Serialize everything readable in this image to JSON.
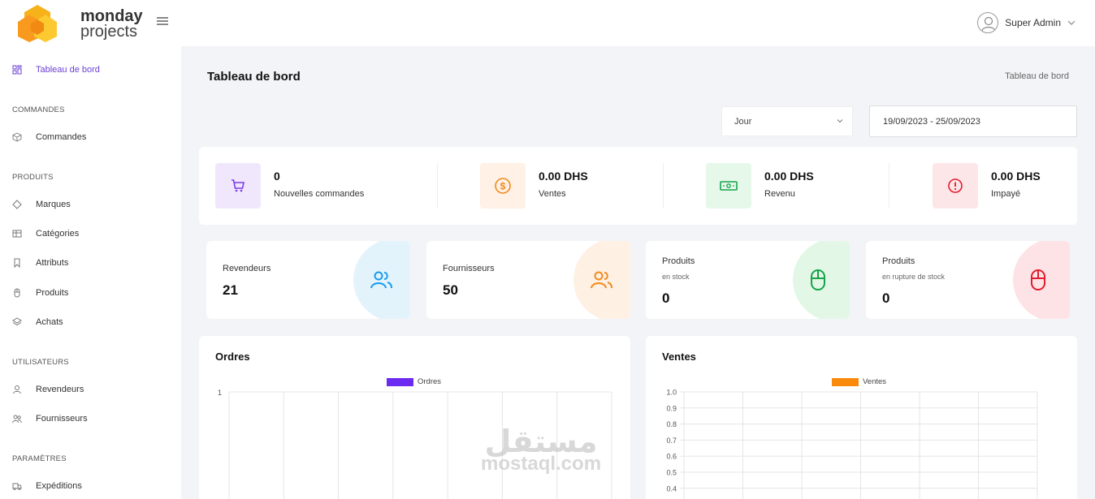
{
  "brand": {
    "line1": "monday",
    "line2": "projects"
  },
  "user": {
    "name": "Super Admin"
  },
  "sidebar": {
    "active": {
      "label": "Tableau de bord"
    },
    "sections": {
      "commandes": "COMMANDES",
      "produits": "PRODUITS",
      "utilisateurs": "UTILISATEURS",
      "parametres": "PARAMÈTRES"
    },
    "items": {
      "commandes": "Commandes",
      "marques": "Marques",
      "categories": "Catégories",
      "attributs": "Attributs",
      "produits": "Produits",
      "achats": "Achats",
      "revendeurs": "Revendeurs",
      "fournisseurs": "Fournisseurs",
      "expeditions": "Expéditions"
    }
  },
  "header": {
    "title": "Tableau de bord",
    "breadcrumb": "Tableau de bord"
  },
  "filters": {
    "period": "Jour",
    "date_range": "19/09/2023 - 25/09/2023"
  },
  "stats": [
    {
      "value": "0",
      "label": "Nouvelles commandes",
      "color": "#7c3aed",
      "bg": "#f0e7fd",
      "icon": "cart-icon"
    },
    {
      "value": "0.00 DHS",
      "label": "Ventes",
      "color": "#f08a1c",
      "bg": "#fff1e6",
      "icon": "dollar-icon"
    },
    {
      "value": "0.00 DHS",
      "label": "Revenu",
      "color": "#16a34a",
      "bg": "#e6f8ea",
      "icon": "money-icon"
    },
    {
      "value": "0.00 DHS",
      "label": "Impayé",
      "color": "#e11d2e",
      "bg": "#fde6e8",
      "icon": "alert-icon"
    }
  ],
  "cards": [
    {
      "title": "Revendeurs",
      "subtitle": "",
      "value": "21",
      "color": "#1a9cf0",
      "bg": "#e3f3fc",
      "icon": "users-icon"
    },
    {
      "title": "Fournisseurs",
      "subtitle": "",
      "value": "50",
      "color": "#f08a1c",
      "bg": "#fff0e4",
      "icon": "users-icon"
    },
    {
      "title": "Produits",
      "subtitle": "en stock",
      "value": "0",
      "color": "#16a34a",
      "bg": "#e3f7e7",
      "icon": "mouse-icon"
    },
    {
      "title": "Produits",
      "subtitle": "en rupture de stock",
      "value": "0",
      "color": "#e11d2e",
      "bg": "#fde3e5",
      "icon": "mouse-icon"
    }
  ],
  "charts": {
    "ordres": {
      "title": "Ordres",
      "legend": "Ordres",
      "color": "#6c2bf0"
    },
    "ventes": {
      "title": "Ventes",
      "legend": "Ventes",
      "color": "#f98a0c"
    }
  },
  "chart_data": [
    {
      "type": "bar",
      "title": "Ordres",
      "series": [
        {
          "name": "Ordres",
          "values": []
        }
      ],
      "y_ticks": [
        "1"
      ],
      "ylim": [
        0,
        1
      ],
      "grid": true,
      "legend": "top"
    },
    {
      "type": "bar",
      "title": "Ventes",
      "series": [
        {
          "name": "Ventes",
          "values": []
        }
      ],
      "y_ticks": [
        "1.0",
        "0.9",
        "0.8",
        "0.7",
        "0.6",
        "0.5",
        "0.4"
      ],
      "ylim": [
        0,
        1
      ],
      "grid": true,
      "legend": "top"
    }
  ],
  "watermark": {
    "arabic": "مستقل",
    "latin": "mostaql.com"
  }
}
